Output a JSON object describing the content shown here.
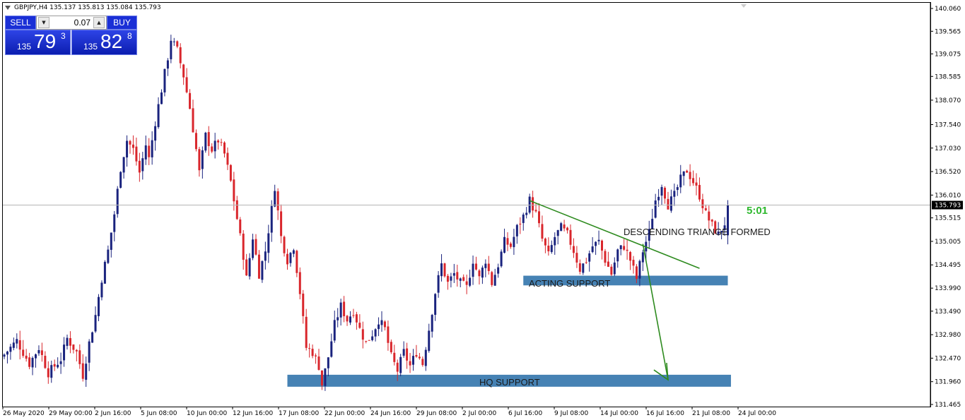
{
  "header": {
    "text": "GBPJPY,H4  135.137 135.813 135.084 135.793"
  },
  "trade_panel": {
    "sell_label": "SELL",
    "buy_label": "BUY",
    "lot": "0.07",
    "sell_price_small": "135",
    "sell_price_big": "79",
    "sell_price_sup": "3",
    "buy_price_small": "135",
    "buy_price_big": "82",
    "buy_price_sup": "8"
  },
  "chart_data": {
    "type": "candlestick",
    "symbol": "GBPJPY",
    "timeframe": "H4",
    "ylim": [
      131.465,
      140.06
    ],
    "y_ticks": [
      "140.060",
      "139.565",
      "139.075",
      "138.585",
      "138.070",
      "137.540",
      "137.030",
      "136.520",
      "136.010",
      "135.515",
      "135.005",
      "134.495",
      "133.990",
      "133.490",
      "132.980",
      "132.470",
      "131.960",
      "131.465"
    ],
    "x_ticks": [
      "26 May 2020",
      "29 May 00:00",
      "2 Jun 16:00",
      "5 Jun 08:00",
      "10 Jun 00:00",
      "12 Jun 16:00",
      "17 Jun 08:00",
      "22 Jun 00:00",
      "24 Jun 16:00",
      "29 Jun 08:00",
      "2 Jul 00:00",
      "6 Jul 16:00",
      "9 Jul 08:00",
      "14 Jul 00:00",
      "16 Jul 16:00",
      "21 Jul 08:00",
      "24 Jul 00:00"
    ],
    "price_path": [
      [
        0,
        132.55
      ],
      [
        4,
        132.85
      ],
      [
        8,
        132.35
      ],
      [
        11,
        132.7
      ],
      [
        14,
        132.15
      ],
      [
        18,
        132.45
      ],
      [
        20,
        132.9
      ],
      [
        23,
        132.6
      ],
      [
        25,
        132.1
      ],
      [
        27,
        132.8
      ],
      [
        29,
        133.4
      ],
      [
        31,
        134.2
      ],
      [
        33,
        134.8
      ],
      [
        35,
        135.6
      ],
      [
        37,
        136.6
      ],
      [
        39,
        137.2
      ],
      [
        41,
        137.0
      ],
      [
        43,
        136.5
      ],
      [
        45,
        137.1
      ],
      [
        46,
        136.8
      ],
      [
        48,
        137.6
      ],
      [
        50,
        138.3
      ],
      [
        52,
        139.0
      ],
      [
        53,
        139.4
      ],
      [
        55,
        139.15
      ],
      [
        57,
        138.6
      ],
      [
        59,
        137.9
      ],
      [
        61,
        137.0
      ],
      [
        62,
        136.5
      ],
      [
        64,
        137.3
      ],
      [
        66,
        137.0
      ],
      [
        68,
        137.2
      ],
      [
        70,
        136.9
      ],
      [
        72,
        136.3
      ],
      [
        74,
        135.5
      ],
      [
        76,
        134.7
      ],
      [
        77,
        134.2
      ],
      [
        79,
        135.1
      ],
      [
        81,
        134.3
      ],
      [
        83,
        134.8
      ],
      [
        85,
        135.7
      ],
      [
        86,
        136.2
      ],
      [
        88,
        135.1
      ],
      [
        90,
        134.6
      ],
      [
        92,
        134.9
      ],
      [
        94,
        133.9
      ],
      [
        96,
        132.7
      ],
      [
        98,
        132.6
      ],
      [
        100,
        132.3
      ],
      [
        101,
        131.9
      ],
      [
        103,
        132.5
      ],
      [
        105,
        133.2
      ],
      [
        107,
        133.6
      ],
      [
        109,
        133.3
      ],
      [
        111,
        133.5
      ],
      [
        113,
        133.1
      ],
      [
        115,
        132.8
      ],
      [
        117,
        133.0
      ],
      [
        119,
        133.3
      ],
      [
        121,
        133.1
      ],
      [
        123,
        132.5
      ],
      [
        125,
        132.2
      ],
      [
        127,
        132.6
      ],
      [
        129,
        132.3
      ],
      [
        131,
        132.6
      ],
      [
        133,
        132.35
      ],
      [
        135,
        133.1
      ],
      [
        137,
        133.9
      ],
      [
        139,
        134.5
      ],
      [
        141,
        134.1
      ],
      [
        143,
        134.3
      ],
      [
        145,
        134.1
      ],
      [
        147,
        134.0
      ],
      [
        149,
        134.6
      ],
      [
        151,
        134.2
      ],
      [
        153,
        134.6
      ],
      [
        155,
        134.1
      ],
      [
        157,
        134.5
      ],
      [
        159,
        135.0
      ],
      [
        161,
        134.9
      ],
      [
        163,
        135.3
      ],
      [
        165,
        135.55
      ],
      [
        167,
        135.9
      ],
      [
        169,
        135.6
      ],
      [
        171,
        135.05
      ],
      [
        173,
        134.7
      ],
      [
        175,
        135.1
      ],
      [
        177,
        135.3
      ],
      [
        179,
        135.15
      ],
      [
        181,
        134.8
      ],
      [
        183,
        134.4
      ],
      [
        185,
        134.6
      ],
      [
        187,
        134.9
      ],
      [
        189,
        135.0
      ],
      [
        191,
        134.6
      ],
      [
        193,
        134.3
      ],
      [
        195,
        134.8
      ],
      [
        197,
        134.9
      ],
      [
        199,
        134.6
      ],
      [
        201,
        134.2
      ],
      [
        203,
        134.8
      ],
      [
        205,
        135.2
      ],
      [
        207,
        135.9
      ],
      [
        209,
        136.25
      ],
      [
        211,
        135.8
      ],
      [
        213,
        136.0
      ],
      [
        215,
        136.35
      ],
      [
        217,
        136.55
      ],
      [
        219,
        136.3
      ],
      [
        221,
        136.0
      ],
      [
        223,
        135.6
      ],
      [
        225,
        135.35
      ],
      [
        227,
        135.15
      ],
      [
        229,
        135.4
      ],
      [
        230,
        135.79
      ]
    ],
    "current_price": "135.793",
    "candle_timer": "5:01",
    "annotations": {
      "descending_triangle": "DESCENDING TRIANGE FORMED",
      "acting_support": "ACTING SUPPORT",
      "hq_support": "HQ SUPPORT"
    },
    "zones": [
      {
        "name": "acting-support-zone",
        "from_index": 165,
        "to_index": 230,
        "y_low": 134.05,
        "y_high": 134.26,
        "color": "#4682b4"
      },
      {
        "name": "hq-support-zone",
        "from_index": 90,
        "to_index": 231,
        "y_low": 131.85,
        "y_high": 132.11,
        "color": "#4682b4"
      }
    ],
    "trendline": {
      "from": [
        167,
        135.89
      ],
      "to": [
        221,
        134.42
      ],
      "color": "#2e8b1f"
    },
    "arrow": {
      "from": [
        203,
        134.95
      ],
      "to": [
        211,
        132.0
      ],
      "color": "#2e8b1f"
    },
    "colors": {
      "bull": "#1a237e",
      "bear": "#d9262c",
      "zone": "#4682b4",
      "lines": "#2e8b1f",
      "price_line": "#b0b0b0"
    }
  }
}
